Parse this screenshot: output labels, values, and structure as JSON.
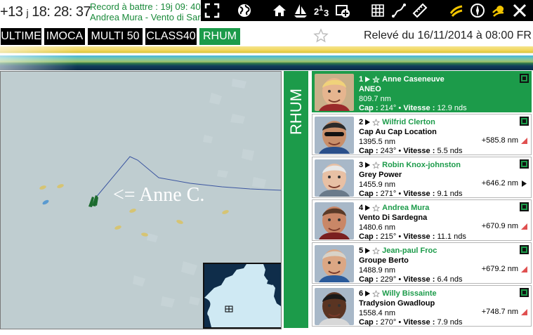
{
  "header": {
    "timer": {
      "days": "+13",
      "unit": "j",
      "time": "18: 28: 37"
    },
    "record": {
      "line1": "Record à battre : 19j 09: 40",
      "line2": "Andrea Mura - Vento di Sardegna"
    },
    "icons": [
      "fullscreen-icon",
      "globe-icon",
      "home-icon",
      "sailboat-icon",
      "podium-icon",
      "add-map-icon",
      "grid-icon",
      "route-icon",
      "ruler-icon",
      "wind-icon",
      "compass-icon",
      "weather-icon",
      "close-icon"
    ]
  },
  "tabs": [
    {
      "label": "ULTIME",
      "active": false
    },
    {
      "label": "IMOCA",
      "active": false
    },
    {
      "label": "MULTI 50",
      "active": false
    },
    {
      "label": "CLASS40",
      "active": false
    },
    {
      "label": "RHUM",
      "active": true
    }
  ],
  "releve": "Relevé du 16/11/2014 à 08:00 FR",
  "map": {
    "annotation": "<= Anne C."
  },
  "ranking": {
    "class_label": "RHUM",
    "entries": [
      {
        "rank": "1",
        "skipper": "Anne Caseneuve",
        "boat": "ANEO",
        "distance": "809.7 nm",
        "gap": "",
        "cap": "214°",
        "vitesse": "12.9 nds",
        "trend": "none",
        "leader": true
      },
      {
        "rank": "2",
        "skipper": "Wilfrid Clerton",
        "boat": "Cap Au Cap Location",
        "distance": "1395.5 nm",
        "gap": "+585.8 nm",
        "cap": "243°",
        "vitesse": "5.5 nds",
        "trend": "up",
        "leader": false
      },
      {
        "rank": "3",
        "skipper": "Robin Knox-johnston",
        "boat": "Grey Power",
        "distance": "1455.9 nm",
        "gap": "+646.2 nm",
        "cap": "271°",
        "vitesse": "9.1 nds",
        "trend": "stable",
        "leader": false
      },
      {
        "rank": "4",
        "skipper": "Andrea Mura",
        "boat": "Vento Di Sardegna",
        "distance": "1480.6 nm",
        "gap": "+670.9 nm",
        "cap": "215°",
        "vitesse": "11.1 nds",
        "trend": "up",
        "leader": false
      },
      {
        "rank": "5",
        "skipper": "Jean-paul Froc",
        "boat": "Groupe Berto",
        "distance": "1488.9 nm",
        "gap": "+679.2 nm",
        "cap": "229°",
        "vitesse": "6.4 nds",
        "trend": "up",
        "leader": false
      },
      {
        "rank": "6",
        "skipper": "Willy Bissainte",
        "boat": "Tradysion Gwadloup",
        "distance": "1558.4 nm",
        "gap": "+748.7 nm",
        "cap": "270°",
        "vitesse": "7.9 nds",
        "trend": "up",
        "leader": false
      }
    ],
    "labels": {
      "cap": "Cap :",
      "vitesse": "Vitesse :",
      "sep": " • "
    }
  },
  "colors": {
    "accent": "#1c9b4a",
    "trend_up": "#e05050"
  }
}
